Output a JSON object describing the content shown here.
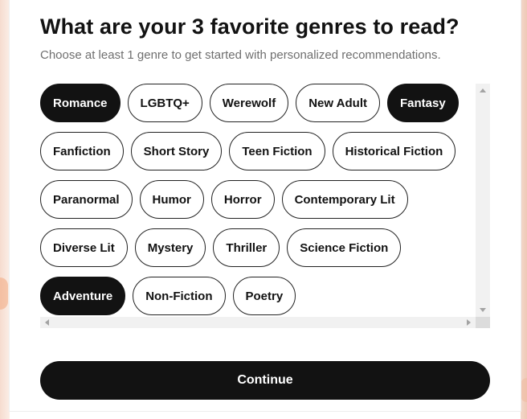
{
  "onboarding": {
    "title": "What are your 3 favorite genres to read?",
    "subtitle": "Choose at least 1 genre to get started with personalized recommendations.",
    "genres": [
      {
        "label": "Romance",
        "selected": true
      },
      {
        "label": "LGBTQ+",
        "selected": false
      },
      {
        "label": "Werewolf",
        "selected": false
      },
      {
        "label": "New Adult",
        "selected": false
      },
      {
        "label": "Fantasy",
        "selected": true
      },
      {
        "label": "Fanfiction",
        "selected": false
      },
      {
        "label": "Short Story",
        "selected": false
      },
      {
        "label": "Teen Fiction",
        "selected": false
      },
      {
        "label": "Historical Fiction",
        "selected": false
      },
      {
        "label": "Paranormal",
        "selected": false
      },
      {
        "label": "Humor",
        "selected": false
      },
      {
        "label": "Horror",
        "selected": false
      },
      {
        "label": "Contemporary Lit",
        "selected": false
      },
      {
        "label": "Diverse Lit",
        "selected": false
      },
      {
        "label": "Mystery",
        "selected": false
      },
      {
        "label": "Thriller",
        "selected": false
      },
      {
        "label": "Science Fiction",
        "selected": false
      },
      {
        "label": "Adventure",
        "selected": true
      },
      {
        "label": "Non-Fiction",
        "selected": false
      },
      {
        "label": "Poetry",
        "selected": false
      }
    ],
    "continue_label": "Continue"
  },
  "colors": {
    "selected_chip_bg": "#121212",
    "selected_chip_text": "#ffffff",
    "chip_border": "#222222",
    "button_bg": "#121212"
  }
}
